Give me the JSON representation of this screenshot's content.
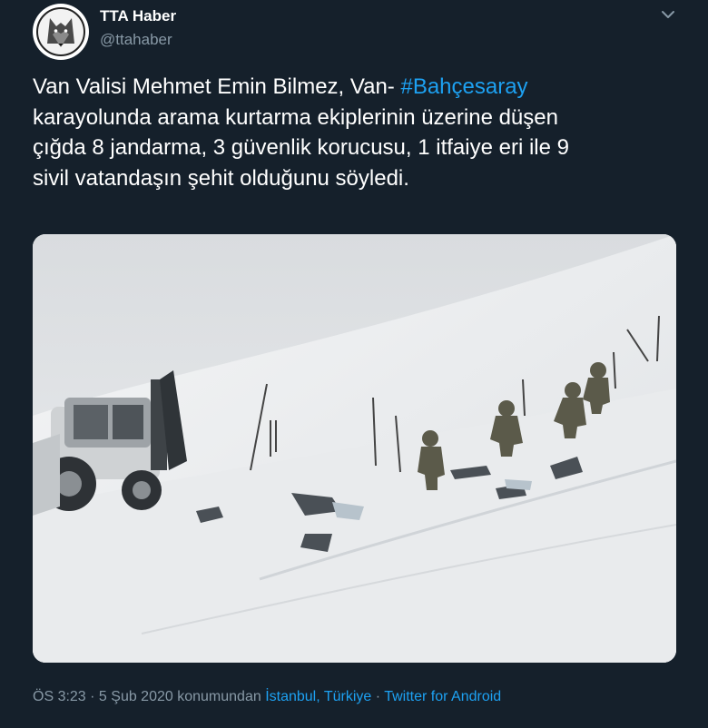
{
  "author": {
    "name": "TTA Haber",
    "handle": "@ttahaber",
    "avatar_icon": "wolf-logo-icon"
  },
  "tweet": {
    "lines": [
      "Van Valisi Mehmet Emin Bilmez, Van- ",
      "karayolunda arama kurtarma ekiplerinin üzerine düşen",
      "çığda 8 jandarma, 3 güvenlik korucusu, 1 itfaiye eri ile 9",
      "sivil vatandaşın şehit olduğunu söyledi."
    ],
    "hashtag": "#Bahçesaray"
  },
  "meta": {
    "time": "ÖS 3:23",
    "sep1": " · ",
    "date": "5 Şub 2020",
    "location_prefix": " konumundan ",
    "location": "İstanbul, Türkiye",
    "sep2": " · ",
    "source": "Twitter for Android"
  },
  "colors": {
    "background": "#15202b",
    "text": "#ffffff",
    "secondary": "#8899a6",
    "accent": "#1da1f2"
  }
}
